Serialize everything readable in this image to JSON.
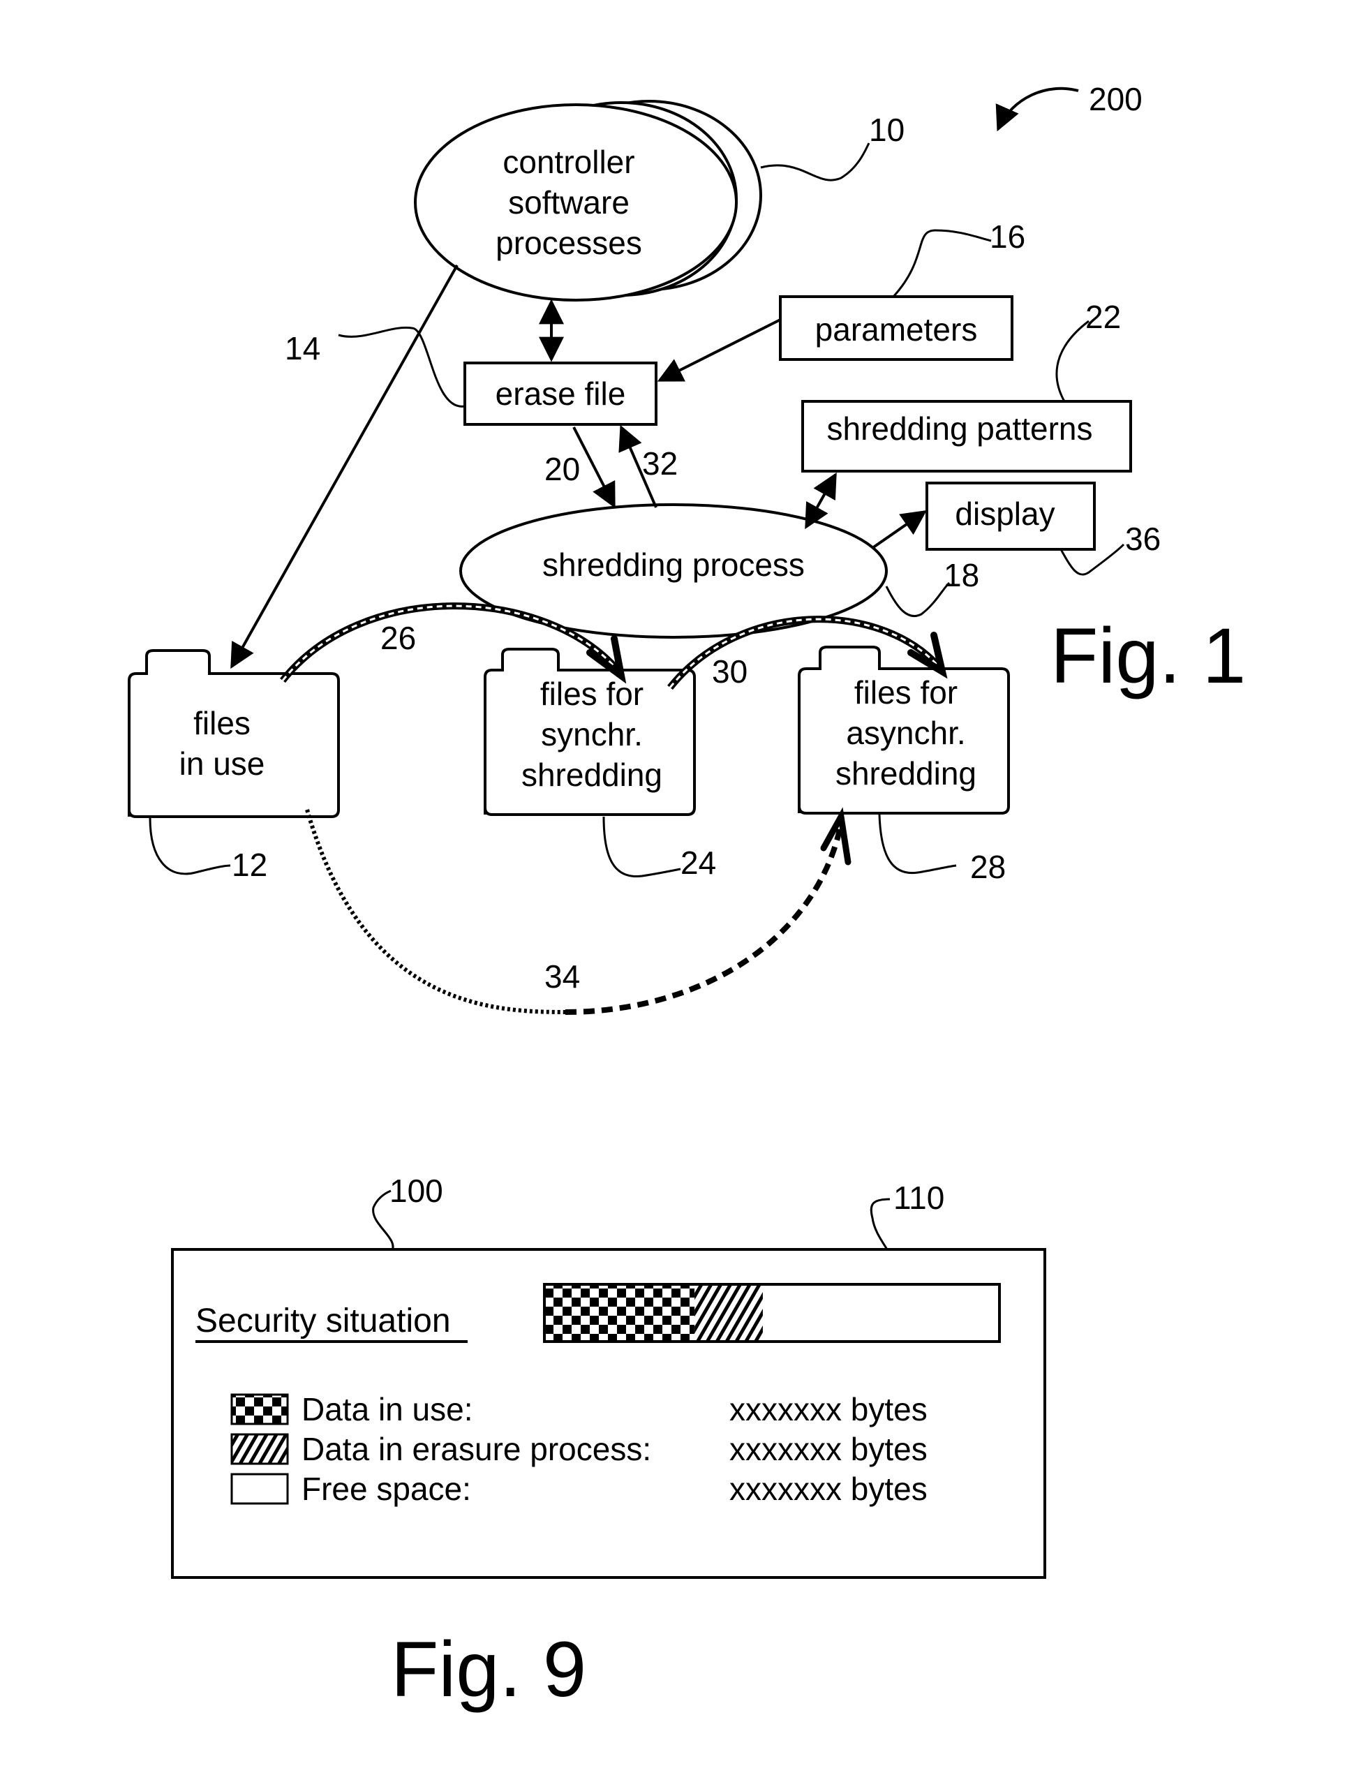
{
  "fig1": {
    "figure_label": "Fig. 1",
    "system_ref": "200",
    "nodes": {
      "controller": {
        "lines": [
          "controller",
          "software",
          "processes"
        ],
        "ref": "10"
      },
      "erase_file": {
        "label": "erase file",
        "ref": "14"
      },
      "parameters": {
        "label": "parameters",
        "ref": "16"
      },
      "shredding_patterns": {
        "label": "shredding patterns",
        "ref": "22"
      },
      "display": {
        "label": "display",
        "ref": "36"
      },
      "shredding_process": {
        "label": "shredding process",
        "ref": "18"
      },
      "files_in_use": {
        "lines": [
          "files",
          "in use"
        ],
        "ref": "12"
      },
      "files_sync": {
        "lines": [
          "files for",
          "synchr.",
          "shredding"
        ],
        "ref": "24"
      },
      "files_async": {
        "lines": [
          "files for",
          "asynchr.",
          "shredding"
        ],
        "ref": "28"
      }
    },
    "edges": {
      "erase_to_shred": "20",
      "shred_to_erase": "32",
      "inuse_to_sync": "26",
      "sync_to_async": "30",
      "inuse_to_async": "34"
    }
  },
  "fig9": {
    "figure_label": "Fig. 9",
    "panel_ref": "100",
    "bar_ref": "110",
    "title": "Security situation",
    "bar_fractions": {
      "in_use": 0.33,
      "erasure": 0.15,
      "free": 0.52
    },
    "legend": [
      {
        "pattern": "checker",
        "label": "Data in use:",
        "value": "xxxxxxx bytes"
      },
      {
        "pattern": "hatch",
        "label": "Data in erasure process:",
        "value": "xxxxxxx bytes"
      },
      {
        "pattern": "empty",
        "label": "Free space:",
        "value": "xxxxxxx bytes"
      }
    ]
  }
}
